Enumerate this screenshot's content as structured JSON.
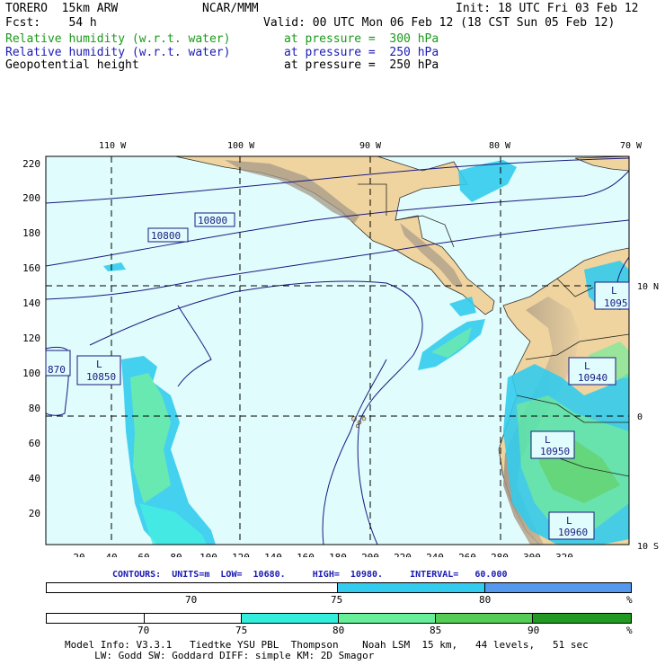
{
  "header": {
    "model": "TORERO  15km ARW",
    "center": "NCAR/MMM",
    "init": "Init: 18 UTC Fri 03 Feb 12",
    "fcst": "Fcst:    54 h",
    "valid": "Valid: 00 UTC Mon 06 Feb 12 (18 CST Sun 05 Feb 12)",
    "fields": [
      {
        "name": "Relative humidity (w.r.t. water)",
        "level": "at pressure =  300 hPa",
        "color": "#1a9a1a"
      },
      {
        "name": "Relative humidity (w.r.t. water)",
        "level": "at pressure =  250 hPa",
        "color": "#1a1ab4"
      },
      {
        "name": "Geopotential height",
        "level": "at pressure =  250 hPa",
        "color": "#000000"
      }
    ]
  },
  "map": {
    "lon_labels": [
      "110 W",
      "100 W",
      "90 W",
      "80 W",
      "70 W"
    ],
    "lat_labels": [
      "10 N",
      "0",
      "10 S"
    ],
    "y_ticks": [
      "220",
      "200",
      "180",
      "160",
      "140",
      "120",
      "100",
      "80",
      "60",
      "40",
      "20"
    ],
    "x_ticks": [
      "20",
      "40",
      "60",
      "80",
      "100",
      "120",
      "140",
      "160",
      "180",
      "200",
      "220",
      "240",
      "260",
      "280",
      "300",
      "320"
    ],
    "contour_labels": [
      "10800",
      "10800",
      "10850",
      "870",
      "10940",
      "1095",
      "10950",
      "10960"
    ],
    "low_labels": [
      "L",
      "L",
      "L",
      "L",
      "L"
    ],
    "colors": {
      "ocean": "#e0fcfc",
      "land": "#f0d4a0",
      "terrain": "#9a9080",
      "contour": "#1a1a80"
    }
  },
  "contour_info": "CONTOURS:  UNITS=m  LOW=  10680.     HIGH=  10980.     INTERVAL=   60.000",
  "legend_250": {
    "ticks": [
      "70",
      "75",
      "80",
      "%"
    ],
    "colors": [
      "#ffffff",
      "#33ccee",
      "#5599ee"
    ]
  },
  "legend_300": {
    "ticks": [
      "70",
      "75",
      "80",
      "85",
      "90",
      "%"
    ],
    "colors": [
      "#ffffff",
      "#ffffff",
      "#33eedd",
      "#66ee99",
      "#55cc55",
      "#229922"
    ]
  },
  "footer": {
    "line1": "Model Info: V3.3.1   Tiedtke YSU PBL  Thompson    Noah LSM  15 km,   44 levels,   51 sec",
    "line2": "     LW: Godd SW: Goddard DIFF: simple KM: 2D Smagor"
  }
}
